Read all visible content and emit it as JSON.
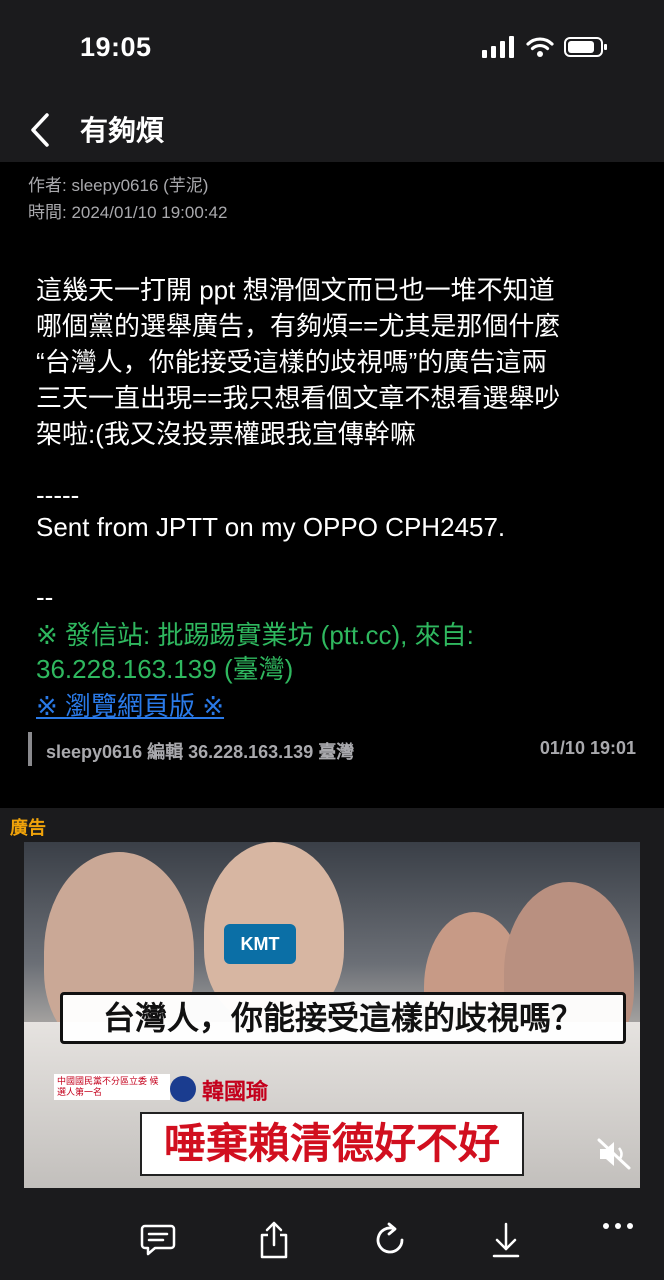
{
  "status": {
    "time": "19:05"
  },
  "nav": {
    "title": "有夠煩"
  },
  "post": {
    "author": "作者: sleepy0616 (芋泥)",
    "date": "時間: 2024/01/10 19:00:42",
    "body_lines": [
      "這幾天一打開 ppt 想滑個文而已也一堆不知道",
      "哪個黨的選舉廣告，有夠煩==尤其是那個什麼",
      "“台灣人，你能接受這樣的歧視嗎”的廣告這兩",
      "三天一直出現==我只想看個文章不想看選舉吵",
      "架啦:(我又沒投票權跟我宣傳幹嘛"
    ],
    "sig_separator": "-----",
    "sent_from": "Sent from JPTT on my OPPO CPH2457.",
    "dash": "--",
    "origin_line1": "※ 發信站: 批踢踢實業坊 (ptt.cc), 來自:",
    "origin_line2": "36.228.163.139 (臺灣)",
    "web_link": "※ 瀏覽網頁版 ※",
    "edit_info": "sleepy0616 編輯 36.228.163.139 臺灣",
    "edit_time": "01/10 19:01"
  },
  "ad": {
    "label": "廣告",
    "mic_text": "KMT",
    "caption_top": "台灣人，你能接受這樣的歧視嗎？",
    "caption_small": "中國國民黨不分區立委 候選人第一名",
    "candidate": "韓國瑜",
    "caption_bottom": "唾棄賴清德好不好"
  },
  "icons": {
    "back": "chevron-left-icon",
    "signal": "signal-icon",
    "wifi": "wifi-icon",
    "battery": "battery-icon",
    "mute": "speaker-muted-icon",
    "comment": "comment-icon",
    "share": "share-icon",
    "refresh": "refresh-icon",
    "download": "arrow-down-icon",
    "more": "more-icon"
  },
  "colors": {
    "background": "#000000",
    "bar": "#1b1b1d",
    "meta_text": "#a9a9ad",
    "origin_green": "#2fb85f",
    "link_blue": "#2a7ae8",
    "ad_label": "#f0a30a"
  }
}
